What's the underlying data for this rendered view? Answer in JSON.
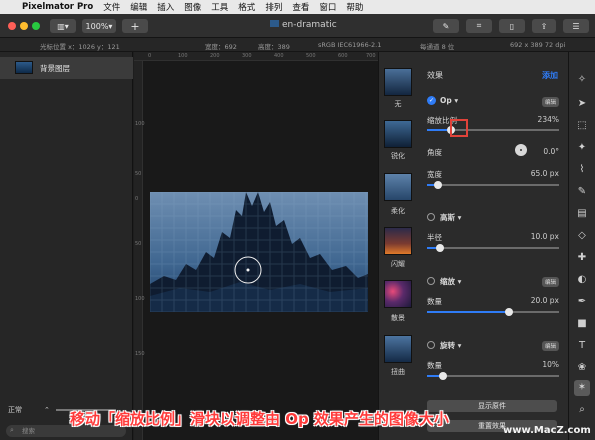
{
  "menubar": {
    "app": "Pixelmator Pro",
    "items": [
      "文件",
      "编辑",
      "插入",
      "图像",
      "工具",
      "格式",
      "排列",
      "查看",
      "窗口",
      "帮助"
    ]
  },
  "toolbar": {
    "zoom": "100%",
    "add": "+",
    "title": "en-dramatic"
  },
  "infobar": {
    "cursor": "光标位置 x：1026  y：121",
    "width": "宽度：692",
    "height": "高度：389",
    "profile": "sRGB IEC61966-2.1",
    "bits": "每通道 8 位",
    "dims": "692 x 389 72 dpi"
  },
  "layers": {
    "item": "背景图层",
    "blend": "正常",
    "search_placeholder": "搜索"
  },
  "ruler": {
    "h": [
      "0",
      "100",
      "200",
      "300",
      "400",
      "500",
      "600",
      "700"
    ],
    "v": [
      "100",
      "50",
      "0",
      "50",
      "100",
      "150"
    ]
  },
  "effects": {
    "header": "效果",
    "add": "添加",
    "thumbs": [
      "无",
      "锐化",
      "柔化",
      "闪耀",
      "散景",
      "扭曲"
    ],
    "op": {
      "title": "Op",
      "badge": "编辑",
      "scale_label": "缩放比例",
      "scale_value": "234%",
      "scale_fraction": 0.18,
      "angle_label": "角度",
      "angle_value": "0.0°",
      "width_label": "宽度",
      "width_value": "65.0 px",
      "width_fraction": 0.08
    },
    "gauss": {
      "title": "高斯",
      "radius_label": "半径",
      "radius_value": "10.0 px",
      "radius_fraction": 0.1
    },
    "zoom": {
      "title": "缩放",
      "badge": "编辑",
      "amount_label": "数量",
      "amount_value": "20.0 px",
      "amount_fraction": 0.62
    },
    "spin": {
      "title": "旋转",
      "badge": "编辑",
      "amount_label": "数量",
      "amount_value": "10%",
      "amount_fraction": 0.12
    },
    "show_original": "显示原件",
    "reset": "重置效果"
  },
  "caption": "移动「缩放比例」滑块以调整由 Op 效果产生的图像大小",
  "watermark": "www.MacZ.com",
  "colors": {
    "accent": "#2f7cf6",
    "highlight": "#e0433a",
    "caption": "#ff3b3b"
  }
}
